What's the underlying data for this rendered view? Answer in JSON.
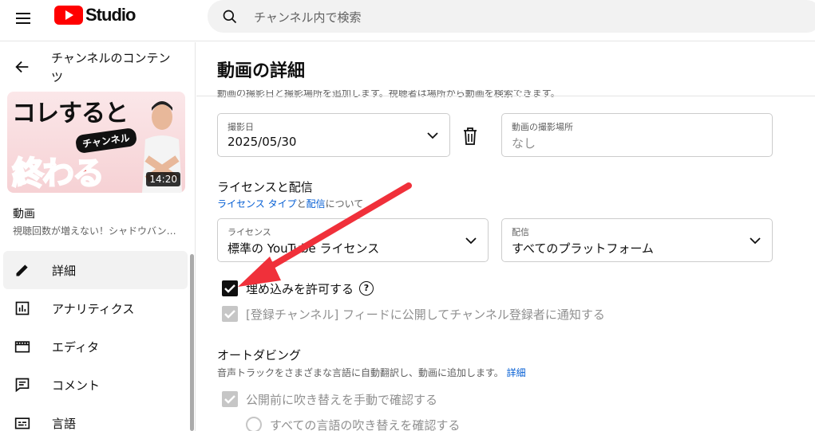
{
  "header": {
    "logo_text": "Studio",
    "search_placeholder": "チャンネル内で検索"
  },
  "sidebar": {
    "title": "チャンネルのコンテンツ",
    "thumbnail": {
      "line1": "コレすると",
      "tag": "チャンネル",
      "line2": "終わる",
      "duration": "14:20"
    },
    "video_label": "動画",
    "video_title": "視聴回数が増えない！シャドウバン…",
    "items": [
      {
        "label": "詳細",
        "icon": "pencil-icon",
        "active": true
      },
      {
        "label": "アナリティクス",
        "icon": "analytics-icon",
        "active": false
      },
      {
        "label": "エディタ",
        "icon": "editor-icon",
        "active": false
      },
      {
        "label": "コメント",
        "icon": "comment-icon",
        "active": false
      },
      {
        "label": "言語",
        "icon": "subtitles-icon",
        "active": false
      }
    ]
  },
  "main": {
    "page_title": "動画の詳細",
    "cut_text": "動画の撮影日と撮影場所を追加します。視聴者は場所から動画を検索できます。",
    "recording_date": {
      "label": "撮影日",
      "value": "2025/05/30"
    },
    "location": {
      "label": "動画の撮影場所",
      "placeholder": "なし"
    },
    "license_section": {
      "title": "ライセンスと配信",
      "link1": "ライセンス タイプ",
      "mid": "と",
      "link2": "配信",
      "tail": "について"
    },
    "license": {
      "label": "ライセンス",
      "value": "標準の YouTube ライセンス"
    },
    "distribution": {
      "label": "配信",
      "value": "すべてのプラットフォーム"
    },
    "allow_embedding": {
      "label": "埋め込みを許可する",
      "checked": true
    },
    "notify_subscribers": {
      "label": "[登録チャンネル] フィードに公開してチャンネル登録者に通知する",
      "checked": true,
      "disabled": true
    },
    "dubbing_section": {
      "title": "オートダビング",
      "subtitle": "音声トラックをさまざまな言語に自動翻訳し、動画に追加します。",
      "link": "詳細"
    },
    "manual_review": {
      "label": "公開前に吹き替えを手動で確認する",
      "checked": true,
      "disabled": true
    },
    "review_all": {
      "label": "すべての言語の吹き替えを確認する"
    }
  },
  "colors": {
    "accent_red": "#ff0000",
    "link_blue": "#065fd4",
    "arrow_red": "#f0303a"
  }
}
